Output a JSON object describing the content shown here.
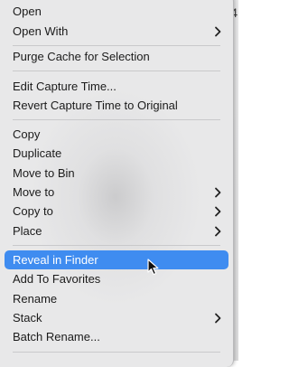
{
  "background": {
    "edge_glyph": "4"
  },
  "menu": {
    "items": [
      {
        "label": "Open",
        "submenu": false
      },
      {
        "label": "Open With",
        "submenu": true
      },
      {
        "label": "Purge Cache for Selection",
        "submenu": false
      },
      {
        "label": "Edit Capture Time...",
        "submenu": false
      },
      {
        "label": "Revert Capture Time to Original",
        "submenu": false
      },
      {
        "label": "Copy",
        "submenu": false
      },
      {
        "label": "Duplicate",
        "submenu": false
      },
      {
        "label": "Move to Bin",
        "submenu": false
      },
      {
        "label": "Move to",
        "submenu": true
      },
      {
        "label": "Copy to",
        "submenu": true
      },
      {
        "label": "Place",
        "submenu": true
      },
      {
        "label": "Reveal in Finder",
        "submenu": false,
        "highlighted": true
      },
      {
        "label": "Add To Favorites",
        "submenu": false
      },
      {
        "label": "Rename",
        "submenu": false
      },
      {
        "label": "Stack",
        "submenu": true
      },
      {
        "label": "Batch Rename...",
        "submenu": false
      }
    ]
  },
  "colors": {
    "highlight": "#3f8cf0",
    "menu_bg": "#e8e8e9",
    "text": "#1b1b1b"
  },
  "icons": {
    "submenu": "chevron-right-icon",
    "pointer": "mouse-pointer-icon"
  }
}
